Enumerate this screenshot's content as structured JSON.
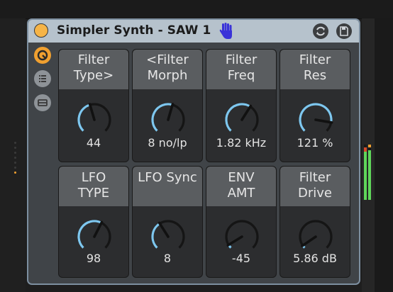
{
  "device": {
    "title": "Simpler Synth -  SAW 1",
    "colors": {
      "titlebar": "#b6c2cc",
      "body": "#404448",
      "power": "#f6b447",
      "knob_arc": "#7ec7ef",
      "hand_icon": "#3a32d8",
      "active_dot": "#f0a030"
    },
    "knobs": [
      {
        "label": "Filter\nType>",
        "value": "44",
        "level": 0.44
      },
      {
        "label": "<Filter\nMorph",
        "value": "8 no/lp",
        "level": 0.56
      },
      {
        "label": "Filter\nFreq",
        "value": "1.82 kHz",
        "level": 0.62
      },
      {
        "label": "Filter\nRes",
        "value": "121 %",
        "level": 0.87
      },
      {
        "label": "LFO\nTYPE",
        "value": "98",
        "level": 0.6
      },
      {
        "label": "LFO Sync",
        "value": "8",
        "level": 0.38
      },
      {
        "label": "ENV\nAMT",
        "value": "-45",
        "level": 0.05
      },
      {
        "label": "Filter\nDrive",
        "value": "5.86 dB",
        "level": 0.04
      }
    ]
  }
}
